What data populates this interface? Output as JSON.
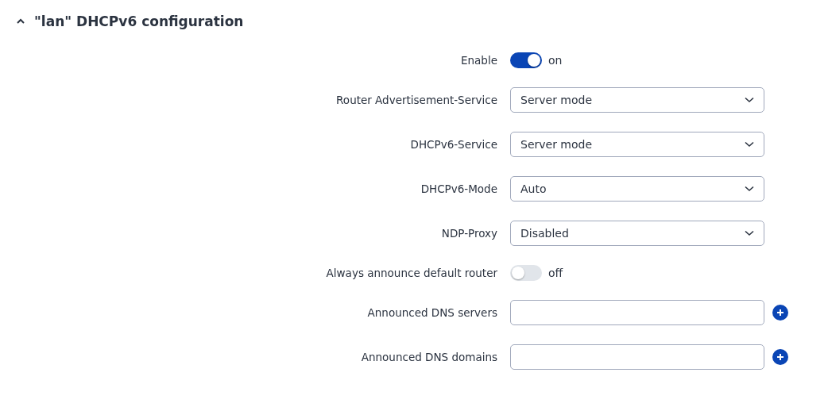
{
  "section": {
    "title": "\"lan\" DHCPv6 configuration",
    "expanded": true
  },
  "rows": [
    {
      "kind": "toggle",
      "label": "Enable",
      "on": true,
      "state_text": "on"
    },
    {
      "kind": "select",
      "label": "Router Advertisement-Service",
      "value": "Server mode"
    },
    {
      "kind": "select",
      "label": "DHCPv6-Service",
      "value": "Server mode"
    },
    {
      "kind": "select",
      "label": "DHCPv6-Mode",
      "value": "Auto"
    },
    {
      "kind": "select",
      "label": "NDP-Proxy",
      "value": "Disabled"
    },
    {
      "kind": "toggle",
      "label": "Always announce default router",
      "on": false,
      "state_text": "off"
    },
    {
      "kind": "input",
      "label": "Announced DNS servers"
    },
    {
      "kind": "input",
      "label": "Announced DNS domains"
    }
  ]
}
